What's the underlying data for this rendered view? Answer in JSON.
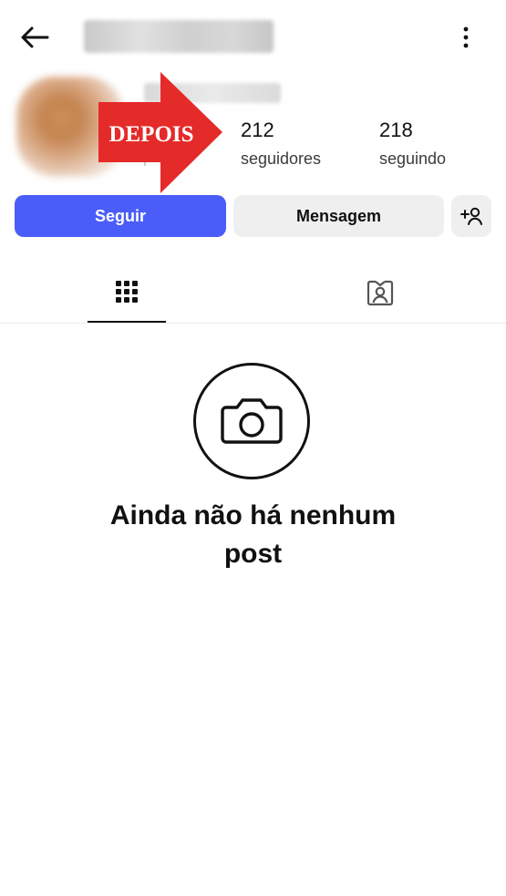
{
  "profile": {
    "arrow_label": "DEPOIS",
    "followers_count": "212",
    "followers_label": "seguidores",
    "following_count": "218",
    "following_label": "seguindo"
  },
  "actions": {
    "follow_label": "Seguir",
    "message_label": "Mensagem"
  },
  "icons": {
    "back": "back-arrow-icon",
    "more": "more-vertical-icon",
    "suggest": "add-user-icon",
    "grid": "grid-icon",
    "tagged": "tagged-person-icon",
    "camera": "camera-icon"
  },
  "empty_state": {
    "title": "Ainda não há nenhum post"
  },
  "colors": {
    "follow_button": "#4a5df9",
    "secondary_button": "#efefef",
    "arrow_overlay": "#e52a2a"
  }
}
